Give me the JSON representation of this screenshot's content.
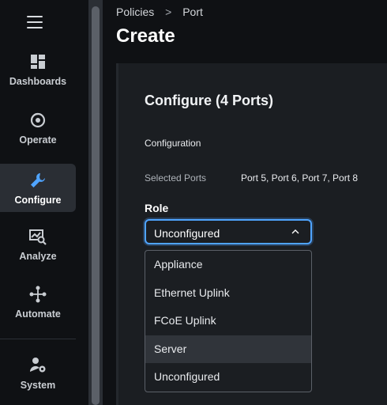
{
  "sidebar": {
    "menu_icon": "hamburger-menu-icon",
    "items": [
      {
        "label": "Dashboards",
        "icon": "dashboards-grid-icon"
      },
      {
        "label": "Operate",
        "icon": "operate-gauge-icon"
      },
      {
        "label": "Configure",
        "icon": "wrench-icon",
        "active": true
      },
      {
        "label": "Analyze",
        "icon": "analyze-chart-search-icon"
      },
      {
        "label": "Automate",
        "icon": "automate-workflow-icon"
      },
      {
        "label": "System",
        "icon": "system-user-gear-icon"
      }
    ]
  },
  "breadcrumb": {
    "items": [
      "Policies",
      "Port"
    ],
    "separator": ">"
  },
  "page": {
    "title": "Create"
  },
  "panel": {
    "title": "Configure (4 Ports)",
    "section": "Configuration",
    "selected_ports_label": "Selected Ports",
    "selected_ports_value": "Port 5, Port 6, Port 7, Port 8",
    "role": {
      "label": "Role",
      "value": "Unconfigured",
      "options": [
        "Appliance",
        "Ethernet Uplink",
        "FCoE Uplink",
        "Server",
        "Unconfigured"
      ],
      "hovered_option": "Server"
    }
  },
  "colors": {
    "accent": "#4fa4ff",
    "active_nav_bg": "#2a2e34",
    "panel_bg": "#1b1e22",
    "app_bg": "#0f1114"
  }
}
